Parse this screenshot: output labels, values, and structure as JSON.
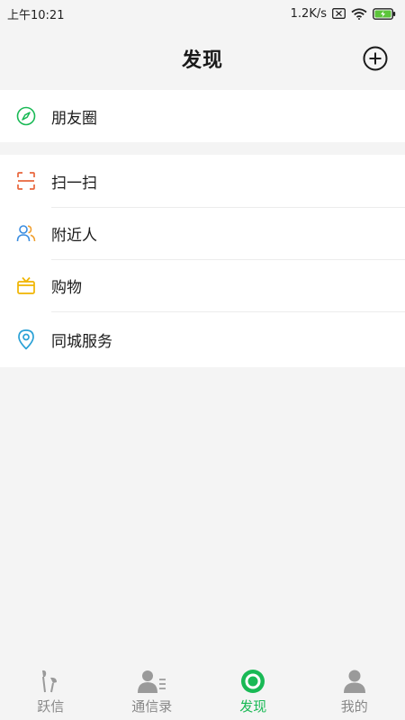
{
  "status_bar": {
    "time": "上午10:21",
    "network_speed": "1.2K/s"
  },
  "header": {
    "title": "发现"
  },
  "groups": [
    {
      "items": [
        {
          "label": "朋友圈",
          "icon": "compass-icon",
          "color": "#19b955"
        }
      ]
    },
    {
      "items": [
        {
          "label": "扫一扫",
          "icon": "scan-icon",
          "color": "#e8663c"
        },
        {
          "label": "附近人",
          "icon": "people-icon",
          "color": "#3b8de0"
        },
        {
          "label": "购物",
          "icon": "gift-icon",
          "color": "#f0b400"
        },
        {
          "label": "同城服务",
          "icon": "location-pin-icon",
          "color": "#2aa1d6"
        }
      ]
    }
  ],
  "tab_bar": {
    "tabs": [
      {
        "label": "跃信",
        "icon": "chat-bubbles-icon",
        "active": false
      },
      {
        "label": "通信录",
        "icon": "contacts-icon",
        "active": false
      },
      {
        "label": "发现",
        "icon": "discover-icon",
        "active": true
      },
      {
        "label": "我的",
        "icon": "person-icon",
        "active": false
      }
    ]
  },
  "colors": {
    "accent": "#19b955",
    "background": "#f4f4f4",
    "battery": "#5cc53a"
  }
}
